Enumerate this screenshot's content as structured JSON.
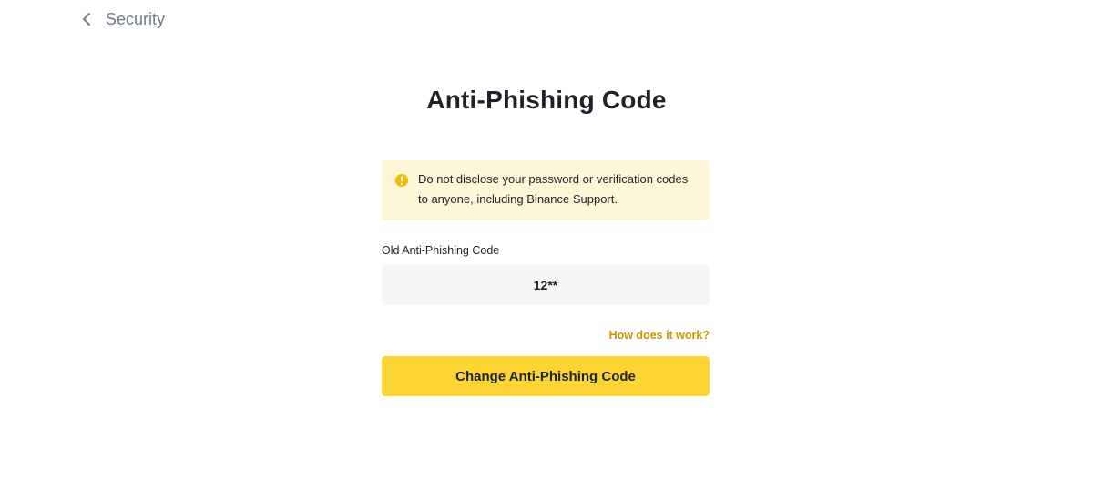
{
  "nav": {
    "back_label": "Security",
    "back_icon": "chevron-left-icon"
  },
  "page": {
    "title": "Anti-Phishing Code"
  },
  "warning": {
    "icon": "exclamation-circle-icon",
    "color": "#f0b90b",
    "background": "#fef6d8",
    "text": "Do not disclose your password or verification codes to anyone, including Binance Support."
  },
  "form": {
    "old_code_label": "Old Anti-Phishing Code",
    "old_code_value": "12**",
    "help_link": "How does it work?",
    "submit_label": "Change Anti-Phishing Code"
  },
  "colors": {
    "accent": "#fcd535",
    "link": "#c99400",
    "text_primary": "#1e2329",
    "text_secondary": "#707a8a",
    "field_background": "#f5f5f5"
  }
}
